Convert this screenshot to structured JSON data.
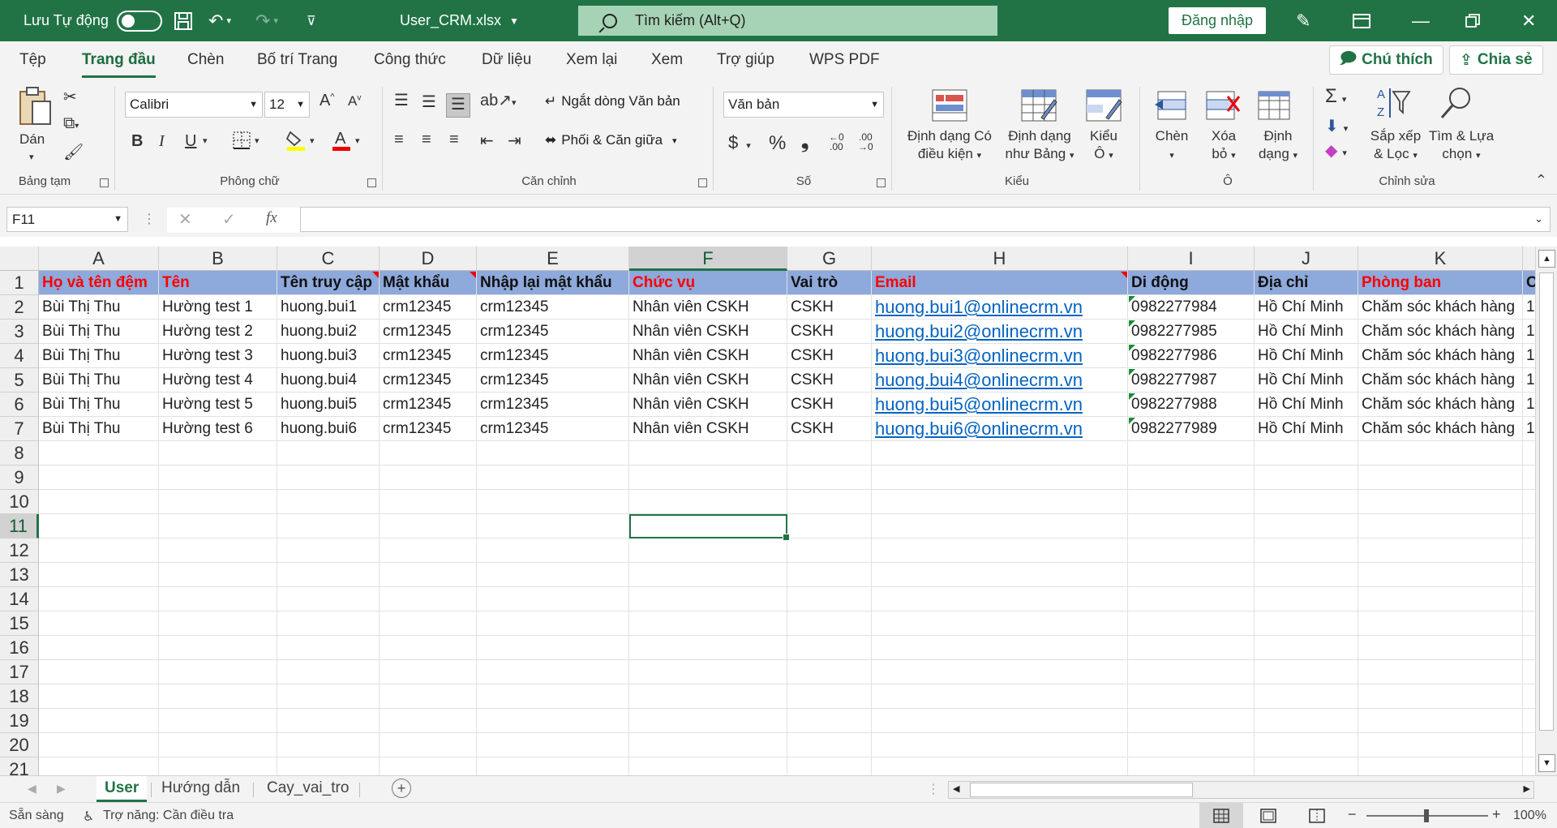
{
  "titlebar": {
    "autosave_label": "Lưu Tự động",
    "filename": "User_CRM.xlsx",
    "search_placeholder": "Tìm kiếm (Alt+Q)",
    "signin_label": "Đăng nhập"
  },
  "tabs": [
    "Tệp",
    "Trang đầu",
    "Chèn",
    "Bố trí Trang",
    "Công thức",
    "Dữ liệu",
    "Xem lại",
    "Xem",
    "Trợ giúp",
    "WPS PDF"
  ],
  "active_tab": "Trang đầu",
  "top_buttons": {
    "comments": "Chú thích",
    "share": "Chia sẻ"
  },
  "ribbon": {
    "clipboard": {
      "paste": "Dán",
      "group": "Bảng tạm"
    },
    "font": {
      "name": "Calibri",
      "size": "12",
      "bold": "B",
      "italic": "I",
      "underline": "U",
      "grow": "A",
      "shrink": "A",
      "group": "Phông chữ"
    },
    "alignment": {
      "wrap": "Ngắt dòng Văn bản",
      "merge": "Phối & Căn giữa",
      "group": "Căn chỉnh"
    },
    "number": {
      "format": "Văn bản",
      "currency": "$",
      "percent": "%",
      "comma": "❟",
      "inc_decimal": ".00",
      "dec_decimal": ".00",
      "group": "Số"
    },
    "styles": {
      "conditional": [
        "Định dạng Có",
        "điều kiện"
      ],
      "as_table": [
        "Định dạng",
        "như Bảng"
      ],
      "cell_styles": [
        "Kiểu",
        "Ô"
      ],
      "group": "Kiểu"
    },
    "cells": {
      "insert": "Chèn",
      "delete": [
        "Xóa",
        "bỏ"
      ],
      "format": [
        "Định",
        "dạng"
      ],
      "group": "Ô"
    },
    "editing": {
      "sort": [
        "Sắp xếp",
        "& Lọc"
      ],
      "find": [
        "Tìm & Lựa",
        "chọn"
      ],
      "group": "Chỉnh sửa"
    }
  },
  "formula_bar": {
    "name_box": "F11",
    "formula": ""
  },
  "sheet": {
    "columns": [
      "A",
      "B",
      "C",
      "D",
      "E",
      "F",
      "G",
      "H",
      "I",
      "J",
      "K"
    ],
    "selected_column": "F",
    "selected_row": "11",
    "rows": [
      "1",
      "2",
      "3",
      "4",
      "5",
      "6",
      "7",
      "8",
      "9",
      "10",
      "11",
      "12",
      "13",
      "14",
      "15",
      "16",
      "17",
      "18",
      "19",
      "20",
      "21"
    ],
    "header_cells": [
      "Họ và tên đệm",
      "Tên",
      "Tên truy cập",
      "Mật khẩu",
      "Nhập lại mật khẩu",
      "Chức vụ",
      "Vai trò",
      "Email",
      "Di động",
      "Địa chỉ",
      "Phòng ban"
    ],
    "header_overflow": "C",
    "data": [
      [
        "Bùi Thị Thu",
        "Hường test 1",
        "huong.bui1",
        "crm12345",
        "crm12345",
        "Nhân viên CSKH",
        "CSKH",
        "huong.bui1@onlinecrm.vn",
        "0982277984",
        "Hồ Chí Minh",
        "Chăm sóc khách hàng",
        "1"
      ],
      [
        "Bùi Thị Thu",
        "Hường test 2",
        "huong.bui2",
        "crm12345",
        "crm12345",
        "Nhân viên CSKH",
        "CSKH",
        "huong.bui2@onlinecrm.vn",
        "0982277985",
        "Hồ Chí Minh",
        "Chăm sóc khách hàng",
        "1"
      ],
      [
        "Bùi Thị Thu",
        "Hường test 3",
        "huong.bui3",
        "crm12345",
        "crm12345",
        "Nhân viên CSKH",
        "CSKH",
        "huong.bui3@onlinecrm.vn",
        "0982277986",
        "Hồ Chí Minh",
        "Chăm sóc khách hàng",
        "1"
      ],
      [
        "Bùi Thị Thu",
        "Hường test 4",
        "huong.bui4",
        "crm12345",
        "crm12345",
        "Nhân viên CSKH",
        "CSKH",
        "huong.bui4@onlinecrm.vn",
        "0982277987",
        "Hồ Chí Minh",
        "Chăm sóc khách hàng",
        "1"
      ],
      [
        "Bùi Thị Thu",
        "Hường test 5",
        "huong.bui5",
        "crm12345",
        "crm12345",
        "Nhân viên CSKH",
        "CSKH",
        "huong.bui5@onlinecrm.vn",
        "0982277988",
        "Hồ Chí Minh",
        "Chăm sóc khách hàng",
        "1"
      ],
      [
        "Bùi Thị Thu",
        "Hường test 6",
        "huong.bui6",
        "crm12345",
        "crm12345",
        "Nhân viên CSKH",
        "CSKH",
        "huong.bui6@onlinecrm.vn",
        "0982277989",
        "Hồ Chí Minh",
        "Chăm sóc khách hàng",
        "1"
      ]
    ]
  },
  "sheet_tabs": [
    "User",
    "Hướng dẫn",
    "Cay_vai_tro"
  ],
  "active_sheet": "User",
  "status": {
    "ready": "Sẵn sàng",
    "accessibility": "Trợ năng: Cần điều tra",
    "zoom": "100%",
    "zoom_minus": "−",
    "zoom_plus": "+"
  },
  "colors": {
    "brand": "#217346",
    "header_fill": "#8ea9db",
    "header_red": "#ff0000",
    "link": "#0563c1"
  },
  "icons": [
    "save-icon",
    "undo-icon",
    "redo-icon",
    "customize-icon",
    "pen-icon",
    "ribbon-display-icon",
    "minimize-icon",
    "restore-icon",
    "close-icon",
    "search-icon"
  ]
}
